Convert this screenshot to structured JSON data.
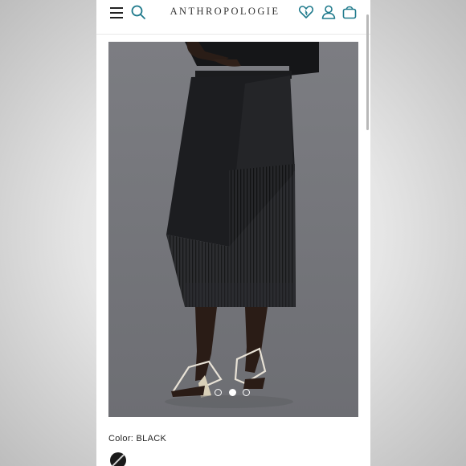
{
  "header": {
    "brand": "ANTHROPOLOGIE",
    "icons": [
      "menu-icon",
      "search-icon",
      "heart-icon",
      "account-icon",
      "bag-icon"
    ],
    "accent_color": "#1f7a8c"
  },
  "gallery": {
    "image_count": 3,
    "active_index": 1
  },
  "product": {
    "color_label": "Color:",
    "color_value": "BLACK",
    "swatch_color": "#1a1a1a"
  }
}
